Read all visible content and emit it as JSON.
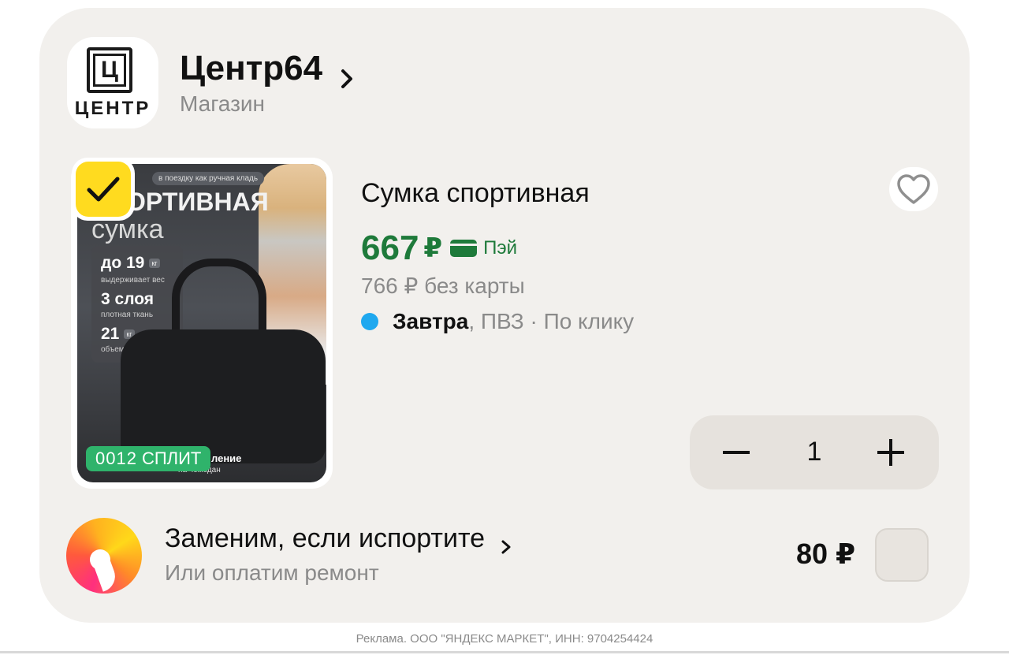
{
  "shop": {
    "logo_letter": "Ц",
    "logo_text": "ЦЕНТР",
    "name": "Центр64",
    "type": "Магазин"
  },
  "product": {
    "image": {
      "tagline": "в поездку как ручная кладь",
      "title_big": "ОРТИВНАЯ",
      "title_sub": "сумка",
      "specs": [
        {
          "value": "до 19",
          "unit": "кг",
          "caption": "выдерживает вес"
        },
        {
          "value": "3 слоя",
          "unit": "",
          "caption": "плотная ткань"
        },
        {
          "value": "21",
          "unit": "кг",
          "caption": "объем"
        }
      ],
      "floor_caption_bold": "ление",
      "floor_caption": "на чемодан"
    },
    "split_badge": {
      "prefix": "0012",
      "label": "СПЛИТ"
    },
    "selected": true,
    "title": "Сумка спортивная",
    "price": "667",
    "currency": "₽",
    "pay_label": "Пэй",
    "price_without_card": "766 ₽ без карты",
    "delivery": {
      "when": "Завтра",
      "details": ", ПВЗ · По клику"
    },
    "quantity": "1",
    "favorite": false
  },
  "warranty": {
    "title": "Заменим, если испортите",
    "subtitle": "Или оплатим ремонт",
    "price": "80 ₽",
    "checked": false
  },
  "footer": {
    "ad_text": "Реклама. ООО \"ЯНДЕКС МАРКЕТ\", ИНН: 9704254424"
  },
  "colors": {
    "card_bg": "#f2f0ed",
    "price_green": "#1e7a3a",
    "check_yellow": "#ffdb1f",
    "delivery_blue": "#1fa8ef",
    "split_green": "#2fb36b"
  },
  "icons": {
    "shop_chevron": "chevron-right-icon",
    "favorite": "heart-icon",
    "checkmark": "check-icon",
    "pay_card": "card-icon",
    "decrement": "minus-icon",
    "increment": "plus-icon",
    "warranty_logo": "yandex-warranty-logo"
  }
}
